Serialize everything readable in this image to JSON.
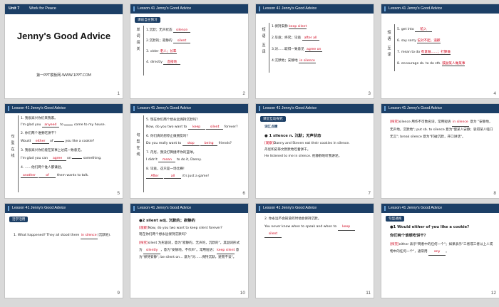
{
  "slides": [
    {
      "num": "1",
      "unit": "Unit 7",
      "unit_title": "Work for Peace",
      "title": "Jenny's Good Advice",
      "footer": "第一PPT模板网-WWW.1PPT.COM"
    },
    {
      "num": "2",
      "header": "Lesson 41 Jenny's Good Advice",
      "tag": "课前自主预习",
      "side": [
        "单",
        "词",
        "闯",
        "关"
      ],
      "items": [
        {
          "n": "1.",
          "text": "沉默；无声状态",
          "ans": "silence"
        },
        {
          "n": "2.",
          "text": "沉默的；寂静的",
          "ans": "silent"
        },
        {
          "n": "3. older",
          "text": "老人；长辈",
          "ans": ""
        },
        {
          "n": "4.",
          "text": "directly",
          "ans": "直接地"
        }
      ]
    },
    {
      "num": "3",
      "header": "Lesson 41 Jenny's Good Advice",
      "side": [
        "短",
        "语",
        "互",
        "译"
      ],
      "items": [
        {
          "n": "1.",
          "text": "保持安静",
          "ans": "keep silent"
        },
        {
          "n": "2.",
          "text": "毕竟；终究；毕竟",
          "ans": "after all"
        },
        {
          "n": "3.",
          "text": "对……取得一致意见",
          "ans": "agree on"
        },
        {
          "n": "4.",
          "text": "沉默地；安静地",
          "ans": "in silence"
        }
      ]
    },
    {
      "num": "4",
      "header": "Lesson 41 Jenny's Good Advice",
      "side": [
        "短",
        "语",
        "互",
        "译"
      ],
      "items": [
        {
          "n": "5.",
          "text": "get into",
          "ans": "陷入"
        },
        {
          "n": "6.",
          "text": "say sorry",
          "ans": "说对不起，道歉"
        },
        {
          "n": "7.",
          "text": "mean to do",
          "ans": "有意做……；打算做"
        },
        {
          "n": "8.",
          "text": "encourage sb. to do sth.",
          "ans": "鼓励某人做某事"
        }
      ]
    },
    {
      "num": "5",
      "header": "Lesson 41 Jenny's Good Advice",
      "side": [
        "句",
        "型",
        "在",
        "线"
      ],
      "lines": [
        "1. 我很高兴你们来我家。",
        "I'm glad you",
        "to",
        "come to my house.",
        "2. 你们两个谁要吃饼干？",
        "Would",
        "of",
        "you like a cookie?",
        "3. 我很高兴你们能在某事上达成一致意见。",
        "I'm glad you can",
        "on",
        "something.",
        "4. ……他们两个谁人都谦逊。",
        "them wants to talk."
      ],
      "answers": [
        "anyeed",
        "either",
        "agree",
        "another",
        "of"
      ]
    },
    {
      "num": "6",
      "header": "Lesson 41 Jenny's Good Advice",
      "side": [
        "句",
        "型",
        "在",
        "线"
      ],
      "lines": [
        "5. 现在你们两个想永远保持沉默吗？",
        "Now, do you two want to",
        "forever?",
        "6. 你们真的想停止做朋友吗？",
        "Do you really want to",
        "friends?",
        "7. 丹尼，我没打算撞坏你的篮球。",
        "I didn't",
        "to",
        "do it, Danny.",
        "8. 毕竟，这只是一场比赛！",
        "it's just a game!"
      ],
      "answers": [
        "keep",
        "silent",
        "stop",
        "being",
        "mean",
        "After",
        "all"
      ]
    },
    {
      "num": "7",
      "header": "Lesson 41 Jenny's Good Advice",
      "tag": "课堂互动探究",
      "sub": "词汇点睛",
      "point": "● 1  silence n. 沉默；无声状态",
      "ex_label": "[观察]",
      "ex1": "Danny and Steven eat their cookies in silence.",
      "ex1_cn": "丹尼和史蒂文默默地吃着饼干。",
      "ex2": "He listened to me in silence. 他静静地听我讲述。"
    },
    {
      "num": "8",
      "header": "Lesson 41 Jenny's Good Advice",
      "label": "[探究]",
      "p1": "silence 用作不可数名词，常用短语",
      "ans1": "in silence",
      "p2": "意为",
      "p3": "\"安静地，无声地，沉默地\"; put sb. to silence 意为\"使某人安静；驳得某人哑口无言\"; break silence 意为\"打破沉默，开口讲话\"。"
    },
    {
      "num": "9",
      "header": "Lesson 41 Jenny's Good Advice",
      "tag": "活学活用",
      "q": "1.  What happened? They all stood there",
      "ans": "in silence",
      "q_cn": "(沉默地)."
    },
    {
      "num": "10",
      "header": "Lesson 41 Jenny's Good Advice",
      "point": "●2   silent adj. 沉默的；寂静的",
      "ex_label": "[观察]",
      "ex": "Now, do you two want to keep silent forever?",
      "ex_cn": "现在你们两个想永远保持沉默吗？",
      "label": "[探究]",
      "p1": "silent 为形容词，意为\"寂静的，无声的，沉默的\"，其副词形式为",
      "ans1": "silently",
      "p2": "，意为\"安静地，不作声\"。常用短语：",
      "ans2": "keep silent",
      "p3": "意为\"保持安静\"; be silent on… 意为\"对……保持沉默，避而不谈\"。"
    },
    {
      "num": "11",
      "header": "Lesson 41 Jenny's Good Advice",
      "q": "2.  你永远不会知道何时他会保持沉默。",
      "q2": "You never know when to speak and when to",
      "ans": "keep",
      "ans2": "silent"
    },
    {
      "num": "12",
      "header": "Lesson 41 Jenny's Good Advice",
      "tag": "句型透视",
      "point": "●1  Would either of you like a cookie?",
      "point_cn": "你们两个谁想吃饼干？",
      "label": "[探究]",
      "p1": "either 表示\"两者中的任何一个\"；如果表示\"三者或三者以上人或物中的任何一个\"，通常用",
      "ans": "any"
    }
  ]
}
